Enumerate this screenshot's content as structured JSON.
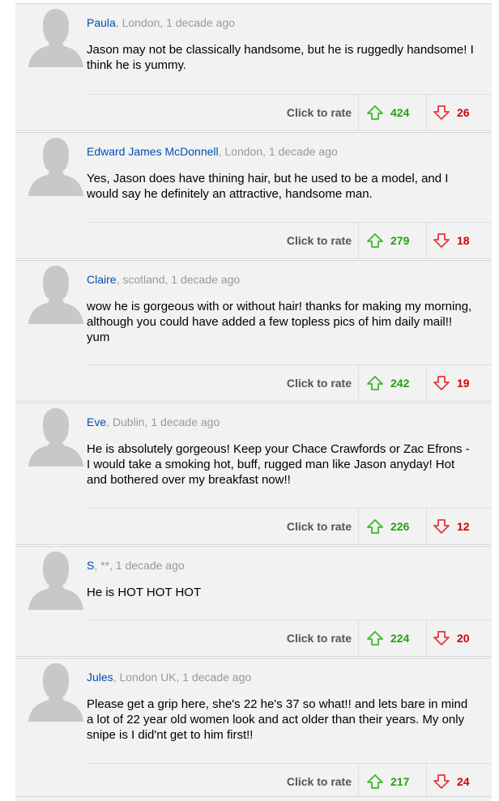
{
  "rating": {
    "click_label": "Click to rate",
    "up_color": "#22a30e",
    "down_color": "#d00000",
    "up_icon": "arrow-up-icon",
    "down_icon": "arrow-down-icon"
  },
  "colors": {
    "author": "#004db3",
    "meta": "#999999",
    "background": "#f2f2f2"
  },
  "comments": [
    {
      "author": "Paula",
      "location": ", London,",
      "time": " 1 decade ago",
      "text": "Jason may not be classically handsome, but he is ruggedly handsome! I think he is yummy.",
      "up": "424",
      "down": "26"
    },
    {
      "author": "Edward James McDonnell",
      "location": ", London,",
      "time": " 1 decade ago",
      "text": "Yes, Jason does have thining hair, but he used to be a model, and I would say he definitely an attractive, handsome man.",
      "up": "279",
      "down": "18"
    },
    {
      "author": "Claire",
      "location": ", scotland,",
      "time": " 1 decade ago",
      "text": "wow he is gorgeous with or without hair! thanks for making my morning, although you could have added a few topless pics of him daily mail!! yum",
      "up": "242",
      "down": "19"
    },
    {
      "author": "Eve",
      "location": ", Dublin,",
      "time": " 1 decade ago",
      "text": "He is absolutely gorgeous! Keep your Chace Crawfords or Zac Efrons - I would take a smoking hot, buff, rugged man like Jason anyday! Hot and bothered over my breakfast now!!",
      "up": "226",
      "down": "12"
    },
    {
      "author": "S",
      "location": ", **,",
      "time": " 1 decade ago",
      "text": "He is HOT HOT HOT",
      "up": "224",
      "down": "20"
    },
    {
      "author": "Jules",
      "location": ", London UK,",
      "time": " 1 decade ago",
      "text": "Please get a grip here, she's 22 he's 37 so what!! and lets bare in mind a lot of 22 year old women look and act older than their years. My only snipe is I did'nt get to him first!!",
      "up": "217",
      "down": "24"
    }
  ]
}
